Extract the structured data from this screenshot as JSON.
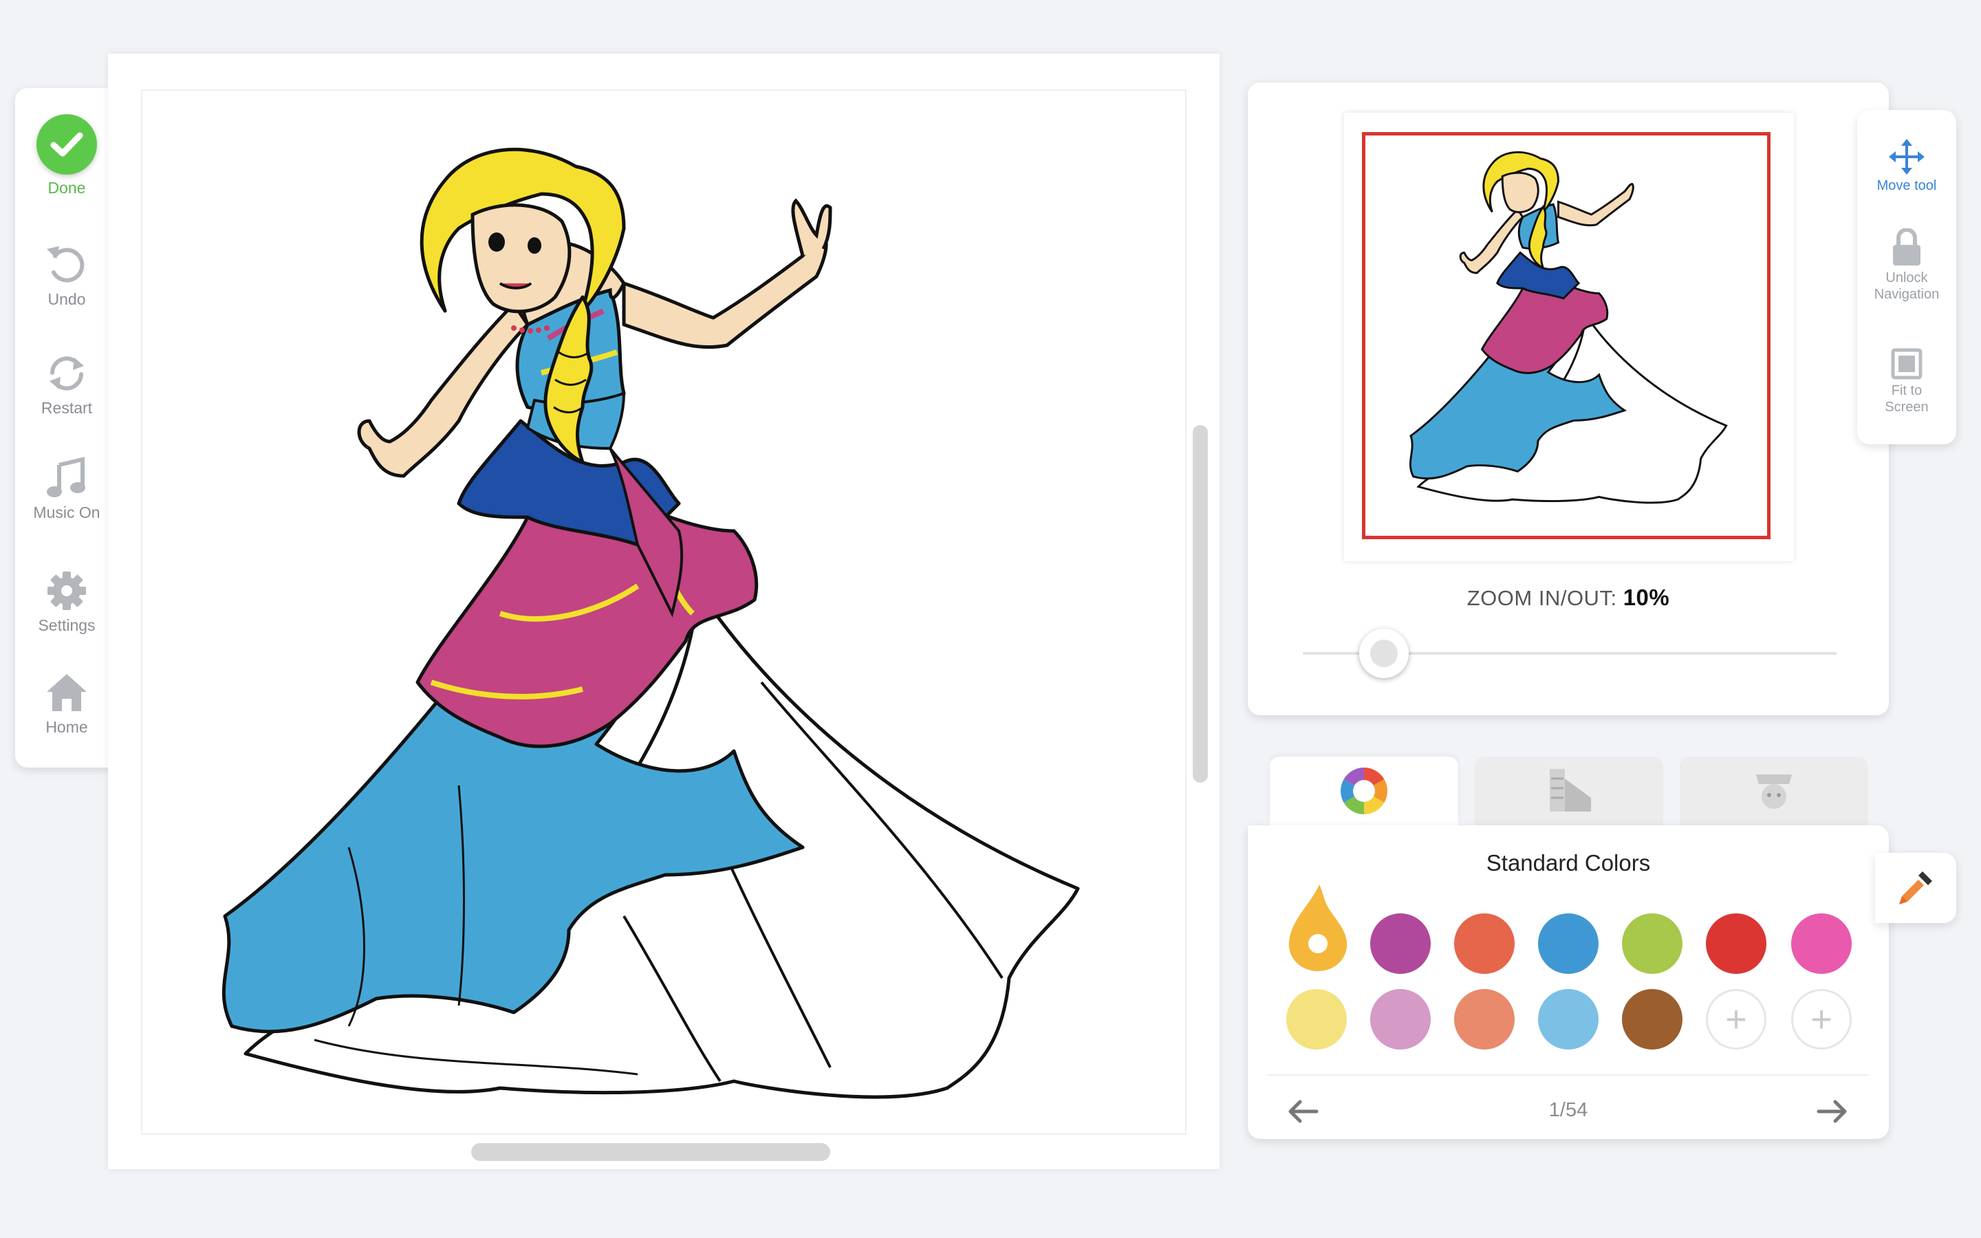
{
  "toolbar": {
    "done": "Done",
    "undo": "Undo",
    "restart": "Restart",
    "music": "Music On",
    "settings": "Settings",
    "home": "Home"
  },
  "navigator": {
    "zoom_label": "ZOOM IN/OUT:",
    "zoom_value": "10%",
    "zoom_level_percent": 10,
    "move_tool": "Move tool",
    "unlock_navigation": [
      "Unlock",
      "Navigation"
    ],
    "fit_to_screen": [
      "Fit to",
      "Screen"
    ]
  },
  "tabs": [
    "color-wheel-icon",
    "pattern-tool-icon",
    "sticker-icon"
  ],
  "palette": {
    "title": "Standard Colors",
    "page": "1/54",
    "row1": [
      "#f4b73a",
      "#b0499b",
      "#e5664a",
      "#3f98d3",
      "#a7c84a",
      "#db3631",
      "#e95aac"
    ],
    "row2": [
      "#f4e27f",
      "#d59ac6",
      "#e98a6d",
      "#7cc0e6",
      "#9b5e2e",
      "add",
      "add"
    ]
  }
}
